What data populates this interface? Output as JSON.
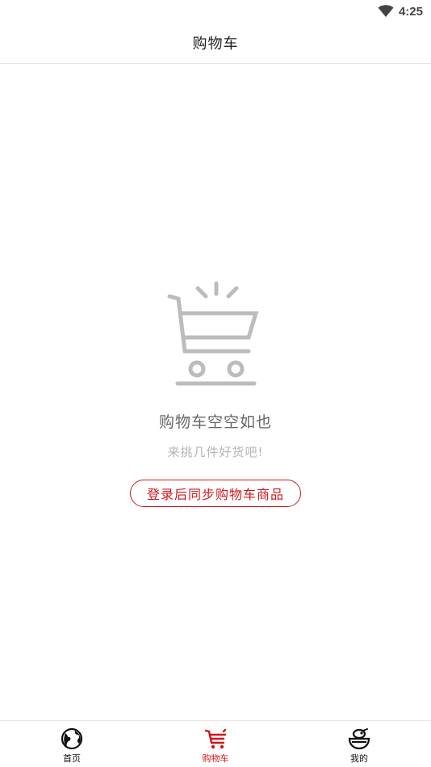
{
  "status_bar": {
    "time": "4:25",
    "wifi_icon": "wifi-icon"
  },
  "header": {
    "title": "购物车"
  },
  "empty_state": {
    "icon": "empty-cart-icon",
    "title": "购物车空空如也",
    "subtitle": "来挑几件好货吧!",
    "button_label": "登录后同步购物车商品"
  },
  "tab_bar": {
    "items": [
      {
        "label": "首页",
        "icon": "globe-icon",
        "active": false
      },
      {
        "label": "购物车",
        "icon": "cart-icon",
        "active": true
      },
      {
        "label": "我的",
        "icon": "profile-bowl-icon",
        "active": false
      }
    ]
  },
  "colors": {
    "accent": "#d0161b",
    "muted_text": "#666666",
    "light_text": "#b5b5b5",
    "icon_gray": "#bcbcbc"
  }
}
